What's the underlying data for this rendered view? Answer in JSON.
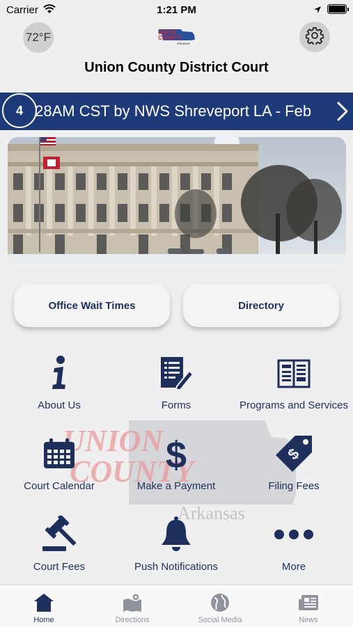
{
  "status_bar": {
    "carrier": "Carrier",
    "time": "1:21 PM"
  },
  "header": {
    "temperature": "72°F",
    "logo_text": [
      "UNION",
      "COUNTY",
      "Arkansas"
    ],
    "title": "Union County District Court"
  },
  "ticker": {
    "count": "4",
    "text": ":28AM CST by NWS Shreveport LA - Feb"
  },
  "buttons": {
    "wait_times": "Office Wait Times",
    "directory": "Directory"
  },
  "watermark": {
    "line1": "UNION",
    "line2": "COUNTY",
    "line3": "Arkansas"
  },
  "tiles": [
    {
      "label": "About Us",
      "icon": "info-icon"
    },
    {
      "label": "Forms",
      "icon": "forms-icon"
    },
    {
      "label": "Programs and Services",
      "icon": "book-icon"
    },
    {
      "label": "Court Calendar",
      "icon": "calendar-icon"
    },
    {
      "label": "Make a Payment",
      "icon": "dollar-icon"
    },
    {
      "label": "Filing Fees",
      "icon": "price-tag-icon"
    },
    {
      "label": "Court Fees",
      "icon": "gavel-icon"
    },
    {
      "label": "Push Notifications",
      "icon": "bell-icon"
    },
    {
      "label": "More",
      "icon": "more-icon"
    }
  ],
  "tabs": [
    {
      "label": "Home",
      "icon": "home-icon",
      "active": true
    },
    {
      "label": "Directions",
      "icon": "map-icon"
    },
    {
      "label": "Social Media",
      "icon": "globe-icon"
    },
    {
      "label": "News",
      "icon": "newspaper-icon"
    }
  ],
  "colors": {
    "brand_navy": "#1e2f5c",
    "ticker_bg": "#1f3a78",
    "logo_red": "#d6222a",
    "tab_inactive": "#8f949c"
  }
}
